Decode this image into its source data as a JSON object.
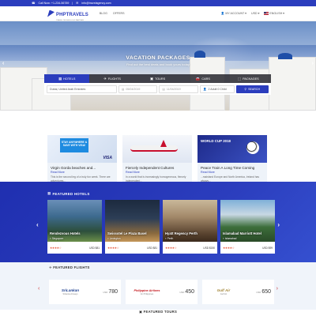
{
  "topbar": {
    "phone": "Call Now: +1-234-56789",
    "email": "info@travelagency.com"
  },
  "header": {
    "logo_text": "PHPTRAVELS",
    "logo_sub": "TRAVEL TECHNOLOGY PARTNER",
    "nav": [
      "BLOG",
      "OFFERS"
    ],
    "account": "MY ACCOUNT",
    "currency": "USD",
    "language": "ENGLISH"
  },
  "hero": {
    "title": "VACATION PACKAGES",
    "subtitle": "Find out the best deals and book yours today"
  },
  "search": {
    "tabs": [
      {
        "label": "HOTELS",
        "icon": "building-icon",
        "active": true
      },
      {
        "label": "FLIGHTS",
        "icon": "plane-icon",
        "active": false
      },
      {
        "label": "TOURS",
        "icon": "suitcase-icon",
        "active": false
      },
      {
        "label": "CARS",
        "icon": "car-icon",
        "active": false
      },
      {
        "label": "PACKAGES",
        "icon": "package-icon",
        "active": false
      }
    ],
    "destination": "Dubai, United Arab Emirates",
    "checkin": "05/04/2019",
    "checkout": "11/04/2019",
    "guests": "2 Adult 0 Child",
    "button": "SEARCH"
  },
  "blog": [
    {
      "title": "Virgin Gorda beaches and...",
      "read": "Read More",
      "desc": "This is the second leg of a truly fun week. There are adventures...",
      "banner": "STAY ANYWHERE & SAVE WITH VISA!",
      "badge": "VISA"
    },
    {
      "title": "Fiercely Independent Cultures",
      "read": "Read More",
      "desc": "In a world that is increasingly homogeneous, fiercely independent...",
      "banner": "",
      "badge": ""
    },
    {
      "title": "Peace Train A Long Time Coming",
      "read": "Read More",
      "desc": "...mainland Europe and North America, Ireland has always...",
      "banner": "WORLD CUP 2018",
      "badge": ""
    }
  ],
  "hotels": {
    "title": "FEATURED HOTELS",
    "items": [
      {
        "name": "Rendezvous Hotels",
        "location": "Singapore",
        "price": "USD $81",
        "stars": "★★★★☆"
      },
      {
        "name": "Swissotel Le Plaza Basel",
        "location": "Lexington",
        "price": "USD $81",
        "stars": "★★★★☆"
      },
      {
        "name": "Hyatt Regency Perth",
        "location": "Perth",
        "price": "USD $150",
        "stars": "★★★★☆"
      },
      {
        "name": "Islamabad Marriott Hotel",
        "location": "Islamabad",
        "price": "USD $99",
        "stars": "★★★★☆"
      }
    ]
  },
  "flights": {
    "title": "FEATURED FLIGHTS",
    "items": [
      {
        "airline": "SriLankan",
        "name": "Srilanka Airways",
        "currency": "USD",
        "price": "780",
        "color": "#1d3f8f"
      },
      {
        "airline": "Philippine Airlines",
        "name": "Air Philippines",
        "currency": "USD",
        "price": "450",
        "color": "#c4161c"
      },
      {
        "airline": "Gulf Air",
        "name": "Gulf Air",
        "currency": "USD",
        "price": "650",
        "color": "#a68a3e"
      }
    ]
  },
  "tours": {
    "title": "FEATURED TOURS"
  },
  "colors": {
    "brand": "#2b3dbd",
    "accent_red": "#e64d2e"
  }
}
